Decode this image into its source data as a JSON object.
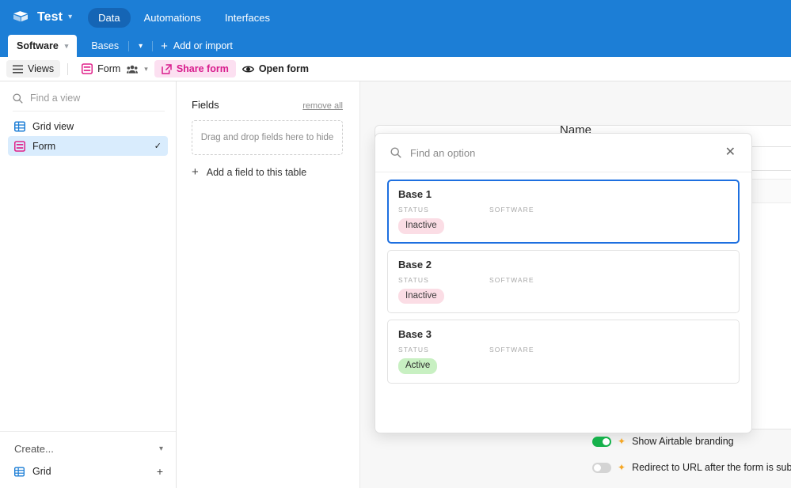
{
  "topbar": {
    "logo_icon": "airtable-cube-icon",
    "base_name": "Test",
    "base_chevron_icon": "chevron-down-icon",
    "nav": [
      {
        "label": "Data",
        "active": true
      },
      {
        "label": "Automations",
        "active": false
      },
      {
        "label": "Interfaces",
        "active": false
      }
    ]
  },
  "tabstrip": {
    "active_table": "Software",
    "active_table_chevron_icon": "chevron-down-icon",
    "bases_label": "Bases",
    "bases_chevron_icon": "chevron-down-icon",
    "add_label": "Add or import",
    "add_icon": "plus-icon"
  },
  "viewbar": {
    "views_label": "Views",
    "views_icon": "hamburger-icon",
    "form_label": "Form",
    "form_icon": "form-view-icon",
    "collaborators_icon": "people-icon",
    "form_chevron_icon": "chevron-down-icon",
    "share_label": "Share form",
    "share_icon": "external-link-icon",
    "open_label": "Open form",
    "open_icon": "eye-icon"
  },
  "sidebar": {
    "search_placeholder": "Find a view",
    "search_icon": "search-icon",
    "items": [
      {
        "label": "Grid view",
        "icon": "grid-view-icon",
        "selected": false
      },
      {
        "label": "Form",
        "icon": "form-view-icon",
        "selected": true,
        "check_icon": "check-icon"
      }
    ],
    "footer": {
      "create_label": "Create...",
      "create_chevron_icon": "chevron-down-icon",
      "grid_label": "Grid",
      "grid_icon": "grid-view-icon",
      "grid_add_icon": "plus-icon"
    }
  },
  "fields_panel": {
    "title": "Fields",
    "remove_all_label": "remove all",
    "dropzone_text": "Drag and drop fields here to hide",
    "add_field_label": "Add a field to this table",
    "add_field_icon": "plus-icon"
  },
  "form": {
    "field_title": "Name"
  },
  "modal": {
    "search_placeholder": "Find an option",
    "search_icon": "search-icon",
    "close_icon": "close-icon",
    "records": [
      {
        "name": "Base 1",
        "focused": true,
        "fields": [
          {
            "label": "STATUS",
            "value": "Inactive",
            "badge": "inactive"
          },
          {
            "label": "SOFTWARE",
            "value": "",
            "badge": null
          }
        ]
      },
      {
        "name": "Base 2",
        "focused": false,
        "fields": [
          {
            "label": "STATUS",
            "value": "Inactive",
            "badge": "inactive"
          },
          {
            "label": "SOFTWARE",
            "value": "",
            "badge": null
          }
        ]
      },
      {
        "name": "Base 3",
        "focused": false,
        "fields": [
          {
            "label": "STATUS",
            "value": "Active",
            "badge": "active"
          },
          {
            "label": "SOFTWARE",
            "value": "",
            "badge": null
          }
        ]
      }
    ]
  },
  "toggles": [
    {
      "label": "Show Airtable branding",
      "on": true,
      "icon": "sparkle-icon"
    },
    {
      "label": "Redirect to URL after the form is submitted",
      "on": false,
      "icon": "sparkle-icon"
    }
  ],
  "colors": {
    "brand_blue": "#1c7ed6",
    "accent_pink": "#d81b8c",
    "focus_blue": "#1d6fe0",
    "toggle_on_green": "#16b14b",
    "badge_inactive_bg": "#fbdde5",
    "badge_active_bg": "#c8f0c2",
    "sparkle_orange": "#f5a623"
  }
}
